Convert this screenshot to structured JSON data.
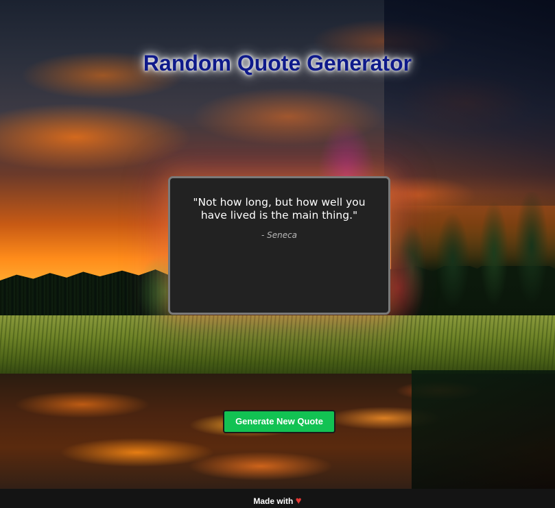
{
  "header": {
    "title": "Random Quote Generator"
  },
  "quote": {
    "text": "\"Not how long, but how well you have lived is the main thing.\"",
    "author": "- Seneca"
  },
  "actions": {
    "generate_label": "Generate New Quote"
  },
  "footer": {
    "made_with": "Made with",
    "heart_icon": "heart-icon",
    "heart_glyph": "♥"
  },
  "colors": {
    "title": "#0f1a8a",
    "card_background": "#222222",
    "card_border": "#7a7a7a",
    "button_background": "#12c253",
    "footer_background": "#141414",
    "heart": "#e53935"
  }
}
